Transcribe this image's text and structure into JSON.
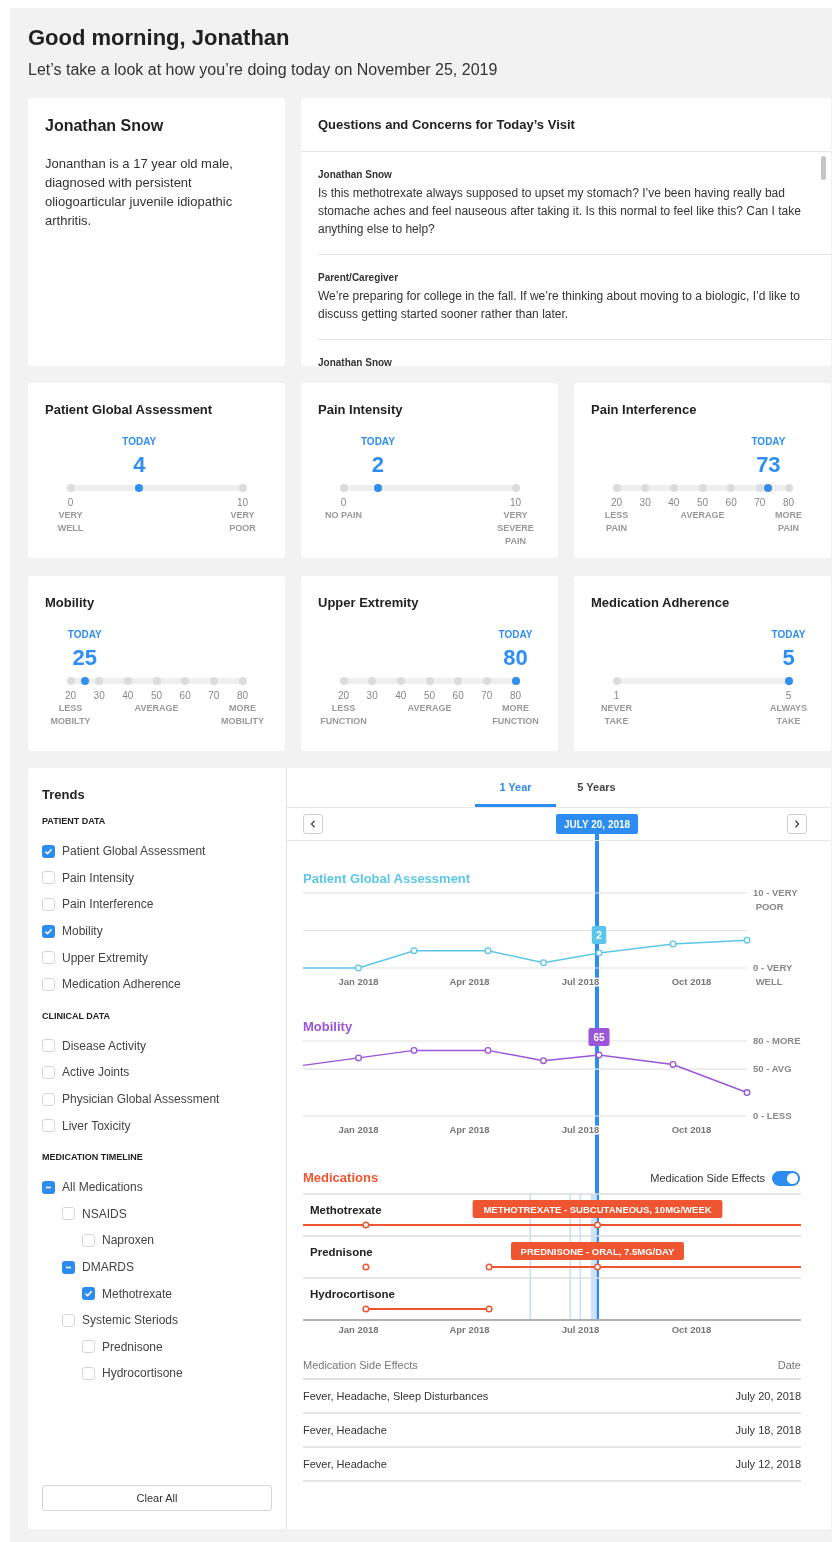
{
  "greeting": "Good morning, Jonathan",
  "subtitle": "Let’s take a look at how you’re doing today on November 25, 2019",
  "patient": {
    "name": "Jonathan Snow",
    "description": "Jonanthan is a 17 year old male, diagnosed with persistent oliogoarticular juvenile idiopathic arthritis."
  },
  "questions": {
    "title": "Questions and Concerns for Today’s Visit",
    "items": [
      {
        "author": "Jonathan Snow",
        "message": "Is this methotrexate always supposed to upset my stomach? I’ve been having really bad stomache aches and feel nauseous after taking it. Is this normal to feel like this? Can I take anything else to help?"
      },
      {
        "author": "Parent/Caregiver",
        "message": "We’re preparing for college in the fall. If we’re thinking about moving to a biologic, I’d like to discuss getting started sooner rather than later."
      },
      {
        "author": "Jonathan Snow"
      }
    ]
  },
  "metrics": [
    {
      "title": "Patient Global Assessment",
      "today_label": "TODAY",
      "value": "4",
      "level": 0.4,
      "ticks": [
        {
          "label": "0",
          "caption": "VERY\nWELL"
        },
        {
          "label": "10",
          "caption": "VERY\nPOOR"
        }
      ]
    },
    {
      "title": "Pain Intensity",
      "today_label": "TODAY",
      "value": "2",
      "level": 0.2,
      "ticks": [
        {
          "label": "0",
          "caption": "NO PAIN"
        },
        {
          "label": "10",
          "caption": "VERY\nSEVERE\nPAIN"
        }
      ]
    },
    {
      "title": "Pain Interference",
      "today_label": "TODAY",
      "value": "73",
      "level": 0.883,
      "ticks": [
        {
          "label": "20",
          "caption": "LESS\nPAIN"
        },
        {
          "label": "30"
        },
        {
          "label": "40"
        },
        {
          "label": "50",
          "caption": "AVERAGE"
        },
        {
          "label": "60"
        },
        {
          "label": "70"
        },
        {
          "label": "80",
          "caption": "MORE\nPAIN"
        }
      ]
    },
    {
      "title": "Mobility",
      "today_label": "TODAY",
      "value": "25",
      "level": 0.083,
      "ticks": [
        {
          "label": "20",
          "caption": "LESS\nMOBILTY"
        },
        {
          "label": "30"
        },
        {
          "label": "40"
        },
        {
          "label": "50",
          "caption": "AVERAGE"
        },
        {
          "label": "60"
        },
        {
          "label": "70"
        },
        {
          "label": "80",
          "caption": "MORE\nMOBILITY"
        }
      ]
    },
    {
      "title": "Upper Extremity",
      "today_label": "TODAY",
      "value": "80",
      "level": 1,
      "ticks": [
        {
          "label": "20",
          "caption": "LESS\nFUNCTION"
        },
        {
          "label": "30"
        },
        {
          "label": "40"
        },
        {
          "label": "50",
          "caption": "AVERAGE"
        },
        {
          "label": "60"
        },
        {
          "label": "70"
        },
        {
          "label": "80",
          "caption": "MORE\nFUNCTION"
        }
      ]
    },
    {
      "title": "Medication Adherence",
      "today_label": "TODAY",
      "value": "5",
      "level": 1,
      "ticks": [
        {
          "label": "1",
          "caption": "NEVER\nTAKE"
        },
        {
          "label": "5",
          "caption": "ALWAYS\nTAKE"
        }
      ]
    }
  ],
  "trends": {
    "title": "Trends",
    "sections": [
      {
        "heading": "PATIENT DATA",
        "items": [
          {
            "label": "Patient Global Assessment",
            "checked": true
          },
          {
            "label": "Pain Intensity",
            "checked": false
          },
          {
            "label": "Pain Interference",
            "checked": false
          },
          {
            "label": "Mobility",
            "checked": true
          },
          {
            "label": "Upper Extremity",
            "checked": false
          },
          {
            "label": "Medication Adherence",
            "checked": false
          }
        ]
      },
      {
        "heading": "CLINICAL DATA",
        "items": [
          {
            "label": "Disease Activity",
            "checked": false
          },
          {
            "label": "Active Joints",
            "checked": false
          },
          {
            "label": "Physician Global Assessment",
            "checked": false
          },
          {
            "label": "Liver Toxicity",
            "checked": false
          }
        ]
      },
      {
        "heading": "MEDICATION TIMELINE",
        "items": [
          {
            "label": "All Medications",
            "checked": true,
            "partial": true,
            "children": [
              {
                "label": "NSAIDS",
                "checked": false,
                "children": [
                  {
                    "label": "Naproxen",
                    "checked": false
                  }
                ]
              },
              {
                "label": "DMARDS",
                "checked": true,
                "partial": true,
                "children": [
                  {
                    "label": "Methotrexate",
                    "checked": true
                  }
                ]
              },
              {
                "label": "Systemic Steriods",
                "checked": false,
                "children": [
                  {
                    "label": "Prednisone",
                    "checked": false
                  },
                  {
                    "label": "Hydrocortisone",
                    "checked": false
                  }
                ]
              }
            ]
          }
        ]
      }
    ],
    "clear_button": "Clear All"
  },
  "chart_view": {
    "tabs": [
      {
        "label": "1 Year",
        "selected": true
      },
      {
        "label": "5 Years",
        "selected": false
      }
    ],
    "selected_date": "JULY 20, 2018",
    "charts": [
      {
        "chart_data": {
          "type": "line",
          "title": "Patient Global Assessment",
          "categories": [
            null,
            null,
            null,
            "Jan 2018",
            null,
            null,
            null,
            null,
            null,
            "Apr 2018",
            null,
            null,
            null,
            null,
            null,
            "Jul 2018",
            null,
            null,
            null,
            null,
            null,
            "Oct 2018",
            null,
            null,
            null
          ],
          "series": [
            {
              "color": "#5cc6ea",
              "marker": "circle",
              "values": [
                0,
                null,
                null,
                0,
                null,
                null,
                2.3,
                null,
                null,
                null,
                2.3,
                null,
                null,
                0.7,
                null,
                null,
                2,
                null,
                null,
                null,
                3.2,
                null,
                null,
                null,
                3.7
              ]
            }
          ],
          "ylim": [
            0,
            10
          ],
          "yticks": [
            {
              "value": 10,
              "label": "10 - VERY POOR"
            },
            {
              "value": 0,
              "label": "0 - VERY WELL"
            }
          ],
          "ref_lines": [
            {
              "axis": "y",
              "value": 5
            }
          ],
          "annotations": [
            {
              "y": 2,
              "text": "2"
            }
          ]
        }
      },
      {
        "chart_data": {
          "type": "line",
          "title": "Mobility",
          "categories": [
            null,
            null,
            null,
            "Jan 2018",
            null,
            null,
            null,
            null,
            null,
            "Apr 2018",
            null,
            null,
            null,
            null,
            null,
            "Jul 2018",
            null,
            null,
            null,
            null,
            null,
            "Oct 2018",
            null,
            null,
            null
          ],
          "series": [
            {
              "color": "#9a55d9",
              "marker": "circle",
              "values": [
                54,
                null,
                null,
                62,
                null,
                null,
                70,
                null,
                null,
                null,
                70,
                null,
                null,
                59,
                null,
                null,
                65,
                null,
                null,
                null,
                55,
                null,
                null,
                null,
                25
              ]
            }
          ],
          "ylim": [
            0,
            80
          ],
          "yticks": [
            {
              "value": 80,
              "label": "80 - MORE"
            },
            {
              "value": 50,
              "label": "50 - AVG"
            },
            {
              "value": 0,
              "label": "0 - LESS"
            }
          ],
          "annotations": [
            {
              "y": 65,
              "text": "65"
            }
          ]
        }
      }
    ],
    "medications": {
      "title": "Medications",
      "side_effects_toggle": {
        "label": "Medication Side Effects",
        "on": true
      },
      "rows": [
        {
          "name": "Methotrexate",
          "callout": "METHOTREXATE - SUBCUTANEOUS, 10MG/WEEK"
        },
        {
          "name": "Prednisone",
          "callout": "PREDNISONE - ORAL, 7.5MG/DAY"
        },
        {
          "name": "Hydrocortisone"
        }
      ],
      "axis_labels": [
        "Jan 2018",
        "Apr 2018",
        "Jul 2018",
        "Oct 2018"
      ]
    },
    "side_effects_table": {
      "columns": [
        "Medication Side Effects",
        "Date"
      ],
      "rows": [
        [
          "Fever, Headache, Sleep Disturbances",
          "July 20, 2018"
        ],
        [
          "Fever, Headache",
          "July 18, 2018"
        ],
        [
          "Fever, Headache",
          "July 12, 2018"
        ]
      ]
    }
  }
}
